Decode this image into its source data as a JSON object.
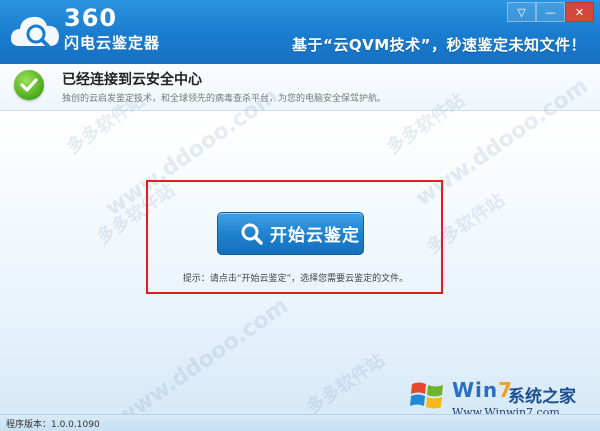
{
  "app": {
    "logo_number": "360",
    "logo_name": "闪电云鉴定器",
    "slogan": "基于“云QVM技术”，秒速鉴定未知文件！",
    "window_buttons": [
      "▽",
      "—",
      "✕"
    ]
  },
  "status": {
    "title": "已经连接到云安全中心",
    "description": "独创的云启发鉴定技术，和全球领先的病毒查杀平台，为您的电脑安全保驾护航。"
  },
  "main": {
    "start_button_label": "开始云鉴定",
    "tip": "提示：请点击“开始云鉴定”，选择您需要云鉴定的文件。"
  },
  "footer": {
    "version": "程序版本：1.0.0.1090"
  },
  "watermark": {
    "site_cn": "多多软件站",
    "site_url": "www.ddooo.com"
  },
  "win7_logo": {
    "brand_prefix": "Win",
    "brand_seven": "7",
    "brand_cn": "系统之家",
    "url": "Www.Winwin7.com"
  },
  "colors": {
    "header_blue": "#1a7ccf",
    "highlight_red": "#e31d1d",
    "button_blue": "#1f82cf",
    "check_green": "#4aaa17"
  }
}
